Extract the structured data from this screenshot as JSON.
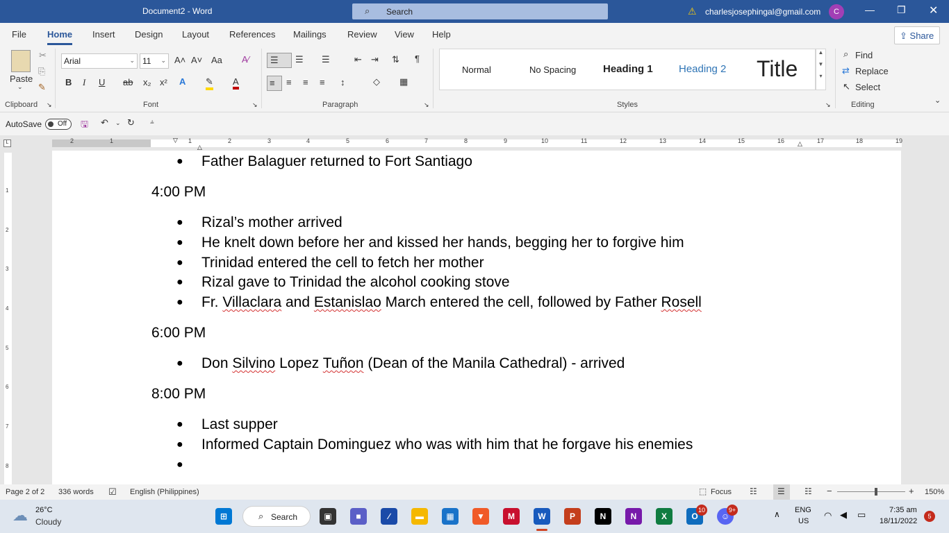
{
  "window": {
    "title": "Document2 - Word",
    "search_label": "Search",
    "account_email": "charlesjosephingal@gmail.com",
    "avatar_initial": "C"
  },
  "tabs": [
    "File",
    "Home",
    "Insert",
    "Design",
    "Layout",
    "References",
    "Mailings",
    "Review",
    "View",
    "Help"
  ],
  "active_tab": "Home",
  "share_label": "Share",
  "ribbon": {
    "clipboard": {
      "paste": "Paste",
      "group": "Clipboard"
    },
    "font": {
      "name": "Arial",
      "size": "11",
      "group": "Font",
      "case": "Aa"
    },
    "paragraph": {
      "group": "Paragraph"
    },
    "styles": {
      "group": "Styles",
      "items": [
        "Normal",
        "No Spacing",
        "Heading 1",
        "Heading 2",
        "Title"
      ]
    },
    "editing": {
      "group": "Editing",
      "find": "Find",
      "replace": "Replace",
      "select": "Select"
    }
  },
  "qat": {
    "autosave": "AutoSave",
    "toggle": "Off"
  },
  "ruler": [
    "2",
    "1",
    "1",
    "2",
    "3",
    "4",
    "5",
    "6",
    "7",
    "8",
    "9",
    "10",
    "11",
    "12",
    "13",
    "14",
    "15",
    "16",
    "17",
    "18",
    "19"
  ],
  "vruler": [
    "1",
    "2",
    "3",
    "4",
    "5",
    "6",
    "7",
    "8"
  ],
  "document": {
    "top_bullet": "Father Balaguer returned to Fort Santiago",
    "section1_time": "4:00 PM",
    "section1_items": [
      "Rizal’s mother arrived",
      "He knelt down before her and kissed her hands, begging her to forgive him",
      "Trinidad entered the cell to fetch her mother",
      "Rizal gave to Trinidad the alcohol cooking stove"
    ],
    "section1_item5": {
      "a": "Fr. ",
      "b": "Villaclara",
      "c": " and ",
      "d": "Estanislao",
      "e": " March entered the cell, followed by Father ",
      "f": "Rosell"
    },
    "section2_time": "6:00 PM",
    "section2_item": {
      "a": "Don ",
      "b": "Silvino",
      "c": " Lopez ",
      "d": "Tuñon",
      "e": " (Dean of the Manila Cathedral) - arrived"
    },
    "section3_time": "8:00 PM",
    "section3_items": [
      "Last supper",
      "Informed Captain Dominguez who was with him that he forgave his enemies"
    ]
  },
  "status": {
    "page": "Page 2 of 2",
    "words": "336 words",
    "language": "English (Philippines)",
    "focus": "Focus",
    "zoom": "150%"
  },
  "taskbar": {
    "temp": "26°C",
    "weather": "Cloudy",
    "search": "Search",
    "lang1": "ENG",
    "lang2": "US",
    "time": "7:35 am",
    "date": "18/11/2022",
    "notif_count": "5",
    "outlook_badge": "10",
    "discord_badge": "9+"
  }
}
